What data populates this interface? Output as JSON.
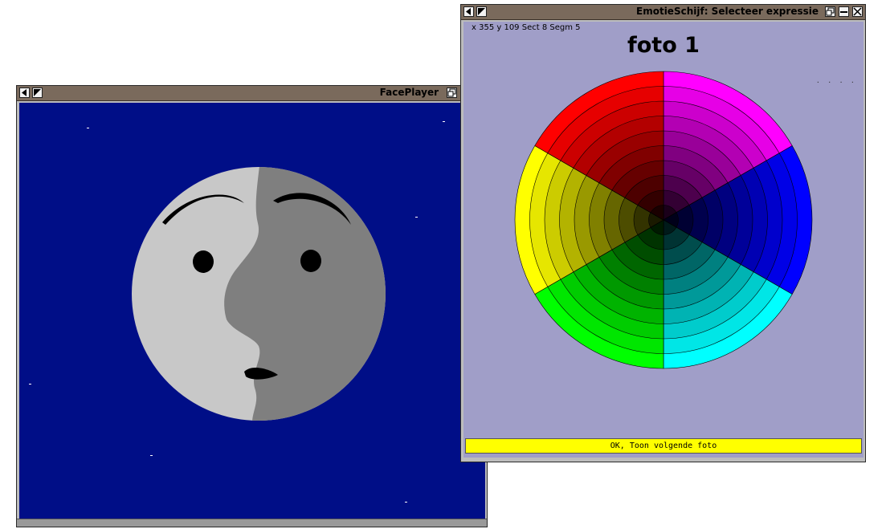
{
  "face_player": {
    "title": "FacePlayer",
    "colors": {
      "background": "#000e87",
      "face_light": "#c8c8c8",
      "face_dark": "#7f7f7f"
    }
  },
  "emotie_schijf": {
    "title": "EmotieSchijf: Selecteer expressie",
    "coords_text": "x 355 y 109 Sect 8 Segm 5",
    "photo_label": "foto 1",
    "corner_dots": ". . . .",
    "ok_button_label": "OK, Toon volgende foto",
    "wheel": {
      "rings": 10,
      "sector_colors": [
        "#ff00ff",
        "#0000ff",
        "#00ffff",
        "#00ff00",
        "#ffff00",
        "#ff0000"
      ],
      "background": "#a09ec8"
    }
  },
  "icons": {
    "arrow_left": "arrow-left-icon",
    "arrow_corner": "corner-arrow-icon",
    "restore": "restore-icon",
    "minimize": "minimize-icon",
    "close": "close-icon"
  }
}
